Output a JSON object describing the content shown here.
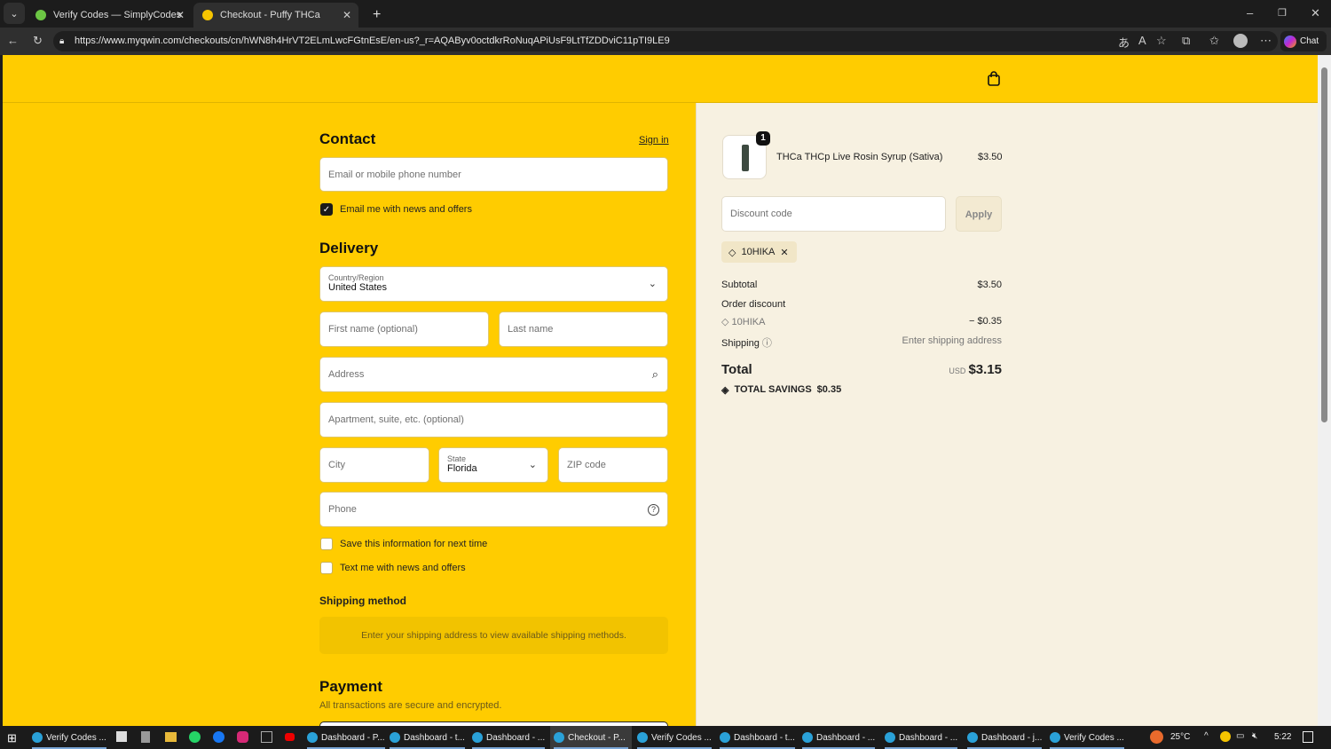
{
  "browser": {
    "tabs": [
      {
        "title": "Verify Codes — SimplyCodes"
      },
      {
        "title": "Checkout - Puffy THCa"
      }
    ],
    "url": "https://www.myqwin.com/checkouts/cn/hWN8h4HrVT2ELmLwcFGtnEsE/en-us?_r=AQAByv0octdkrRoNuqAPiUsF9LtTfZDDviC11pTI9LE9",
    "chat": "Chat"
  },
  "contact": {
    "heading": "Contact",
    "sign_in": "Sign in",
    "email_placeholder": "Email or mobile phone number",
    "email_news": "Email me with news and offers"
  },
  "delivery": {
    "heading": "Delivery",
    "country_label": "Country/Region",
    "country": "United States",
    "first_name": "First name (optional)",
    "last_name": "Last name",
    "address": "Address",
    "apartment": "Apartment, suite, etc. (optional)",
    "city": "City",
    "state_label": "State",
    "state": "Florida",
    "zip": "ZIP code",
    "phone": "Phone",
    "save_info": "Save this information for next time",
    "text_news": "Text me with news and offers"
  },
  "shipping_method": {
    "heading": "Shipping method",
    "notice": "Enter your shipping address to view available shipping methods."
  },
  "payment": {
    "heading": "Payment",
    "subtitle": "All transactions are secure and encrypted."
  },
  "summary": {
    "item": {
      "qty": "1",
      "name": "THCa THCp Live Rosin Syrup (Sativa)",
      "price": "$3.50"
    },
    "discount_placeholder": "Discount code",
    "apply": "Apply",
    "applied_code": "10HIKA",
    "subtotal_label": "Subtotal",
    "subtotal": "$3.50",
    "order_discount_label": "Order discount",
    "discount_code": "10HIKA",
    "discount_amount": "− $0.35",
    "shipping_label": "Shipping",
    "shipping_value": "Enter shipping address",
    "total_label": "Total",
    "currency": "USD",
    "total": "$3.15",
    "savings_label": "TOTAL SAVINGS",
    "savings": "$0.35"
  },
  "taskbar": {
    "items": [
      "Verify Codes ...",
      "Dashboard - P...",
      "Dashboard - t...",
      "Dashboard - ...",
      "Checkout - P...",
      "Verify Codes ...",
      "Dashboard - t...",
      "Dashboard - ...",
      "Dashboard - ...",
      "Dashboard - j...",
      "Verify Codes ..."
    ],
    "weather": "25°C",
    "time": "5:22"
  }
}
